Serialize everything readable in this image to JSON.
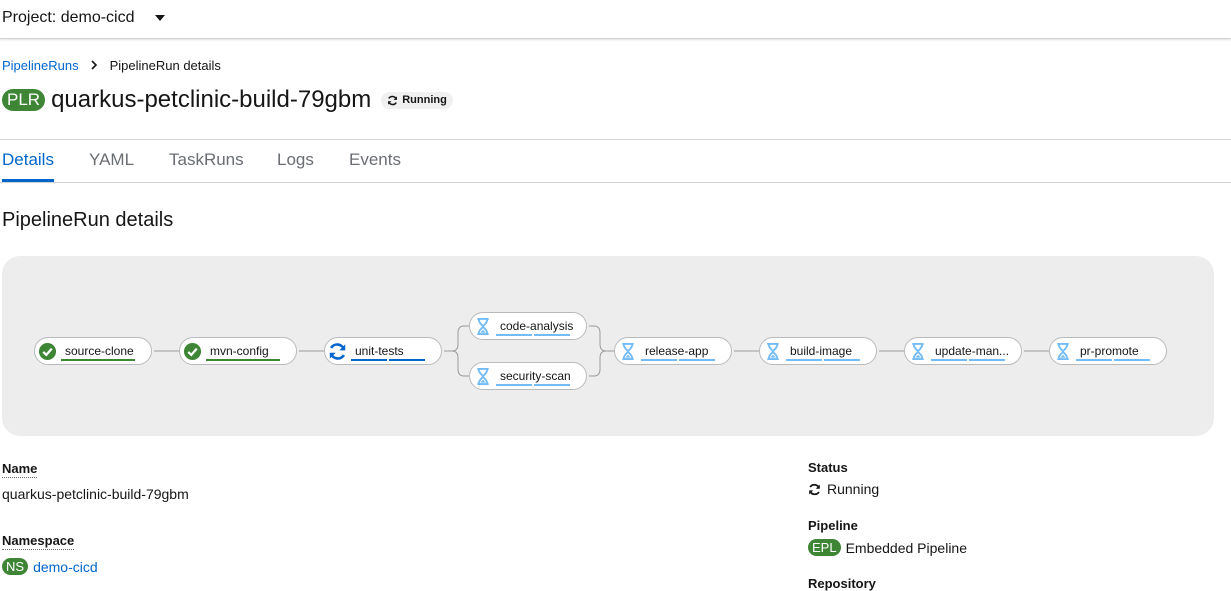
{
  "project": {
    "label": "Project: demo-cicd"
  },
  "breadcrumb": {
    "parent": "PipelineRuns",
    "current": "PipelineRun details"
  },
  "header": {
    "badge": "PLR",
    "title": "quarkus-petclinic-build-79gbm",
    "status": "Running"
  },
  "tabs": [
    {
      "label": "Details",
      "active": true
    },
    {
      "label": "YAML"
    },
    {
      "label": "TaskRuns"
    },
    {
      "label": "Logs"
    },
    {
      "label": "Events"
    }
  ],
  "section": {
    "title": "PipelineRun details"
  },
  "pipeline_graph": {
    "tasks": [
      {
        "name": "source-clone",
        "state": "succeeded",
        "icon": "check-circle-icon"
      },
      {
        "name": "mvn-config",
        "state": "succeeded",
        "icon": "check-circle-icon"
      },
      {
        "name": "unit-tests",
        "state": "running",
        "icon": "sync-icon"
      },
      {
        "name": "code-analysis",
        "state": "pending",
        "icon": "hourglass-icon"
      },
      {
        "name": "security-scan",
        "state": "pending",
        "icon": "hourglass-icon"
      },
      {
        "name": "release-app",
        "state": "pending",
        "icon": "hourglass-icon"
      },
      {
        "name": "build-image",
        "state": "pending",
        "icon": "hourglass-icon"
      },
      {
        "name": "update-man...",
        "state": "pending",
        "icon": "hourglass-icon"
      },
      {
        "name": "pr-promote",
        "state": "pending",
        "icon": "hourglass-icon"
      }
    ],
    "colors": {
      "succeeded": "#3e8635",
      "running": "#0066cc",
      "pending": "#73bcf7"
    }
  },
  "details": {
    "name_label": "Name",
    "name_value": "quarkus-petclinic-build-79gbm",
    "namespace_label": "Namespace",
    "namespace_badge": "NS",
    "namespace_value": "demo-cicd",
    "status_label": "Status",
    "status_value": "Running",
    "pipeline_label": "Pipeline",
    "pipeline_badge": "EPL",
    "pipeline_value": "Embedded Pipeline",
    "repository_label": "Repository"
  }
}
